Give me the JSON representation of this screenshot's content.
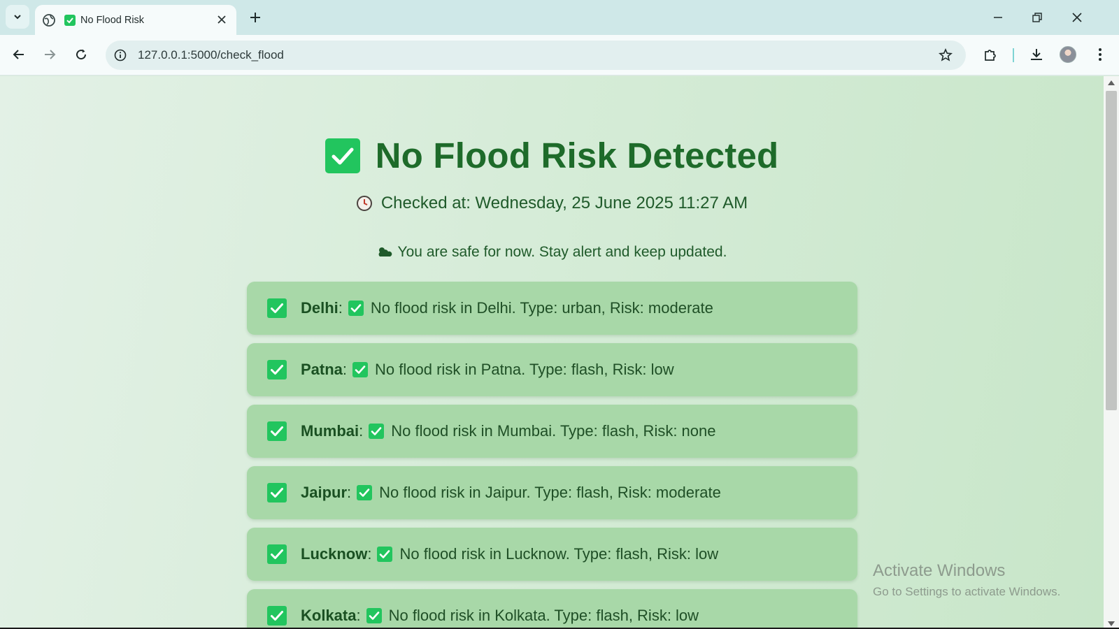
{
  "browser": {
    "tab_title": "No Flood Risk",
    "url": "127.0.0.1:5000/check_flood"
  },
  "page": {
    "heading": "No Flood Risk Detected",
    "checked_at": "Checked at: Wednesday, 25 June 2025 11:27 AM",
    "safe_message": "You are safe for now. Stay alert and keep updated.",
    "cities": [
      {
        "name": "Delhi",
        "message": "No flood risk in Delhi. Type: urban, Risk: moderate"
      },
      {
        "name": "Patna",
        "message": "No flood risk in Patna. Type: flash, Risk: low"
      },
      {
        "name": "Mumbai",
        "message": "No flood risk in Mumbai. Type: flash, Risk: none"
      },
      {
        "name": "Jaipur",
        "message": "No flood risk in Jaipur. Type: flash, Risk: moderate"
      },
      {
        "name": "Lucknow",
        "message": "No flood risk in Lucknow. Type: flash, Risk: low"
      },
      {
        "name": "Kolkata",
        "message": "No flood risk in Kolkata. Type: flash, Risk: low"
      }
    ]
  },
  "watermark": {
    "line1": "Activate Windows",
    "line2": "Go to Settings to activate Windows."
  },
  "colors": {
    "check_green": "#22c55e",
    "heading_green": "#1e6b2a",
    "card_bg": "#a8d8a8"
  }
}
